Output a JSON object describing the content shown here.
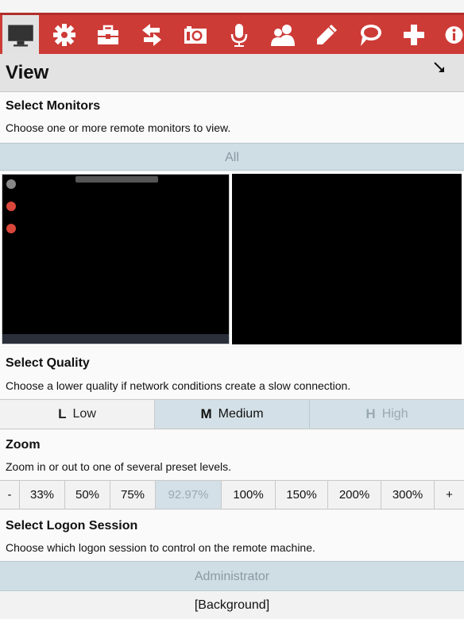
{
  "toolbar": {
    "buttons": [
      {
        "icon": "monitor-icon",
        "active": true
      },
      {
        "icon": "gear-icon"
      },
      {
        "icon": "toolbox-icon"
      },
      {
        "icon": "transfer-arrows-icon"
      },
      {
        "icon": "camera-icon"
      },
      {
        "icon": "microphone-icon"
      },
      {
        "icon": "users-icon"
      },
      {
        "icon": "pencil-icon"
      },
      {
        "icon": "chat-bubble-icon"
      },
      {
        "icon": "plus-icon"
      },
      {
        "icon": "info-icon"
      }
    ],
    "color": "#cd3b37"
  },
  "view": {
    "title": "View"
  },
  "monitors": {
    "title": "Select Monitors",
    "description": "Choose one or more remote monitors to view.",
    "all_label": "All"
  },
  "quality": {
    "title": "Select Quality",
    "description": "Choose a lower quality if network conditions create a slow connection.",
    "options": [
      {
        "letter": "L",
        "label": "Low"
      },
      {
        "letter": "M",
        "label": "Medium"
      },
      {
        "letter": "H",
        "label": "High"
      }
    ]
  },
  "zoom": {
    "title": "Zoom",
    "description": "Zoom in or out to one of several preset levels.",
    "minus": "-",
    "levels": [
      "33%",
      "50%",
      "75%",
      "92.97%",
      "100%",
      "150%",
      "200%",
      "300%"
    ],
    "current": "92.97%",
    "plus": "+"
  },
  "logon": {
    "title": "Select Logon Session",
    "description": "Choose which logon session to control on the remote machine.",
    "sessions": [
      "Administrator",
      "[Background]"
    ]
  }
}
